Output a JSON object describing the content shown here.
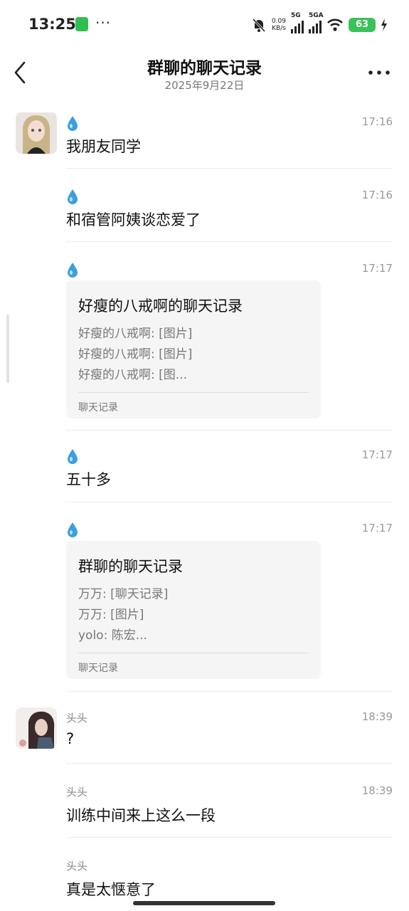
{
  "status_bar": {
    "time": "13:25",
    "dots": "···",
    "speed_value": "0.09",
    "speed_unit": "KB/s",
    "sim1": "5G",
    "sim2": "5GA",
    "battery": "63"
  },
  "header": {
    "title": "群聊的聊天记录",
    "date": "2025年9月22日"
  },
  "messages": [
    {
      "sender": "",
      "time": "17:16",
      "text": "我朋友同学"
    },
    {
      "sender": "",
      "time": "17:16",
      "text": "和宿管阿姨谈恋爱了"
    },
    {
      "sender": "",
      "time": "17:17",
      "card": {
        "title": "好瘦的八戒啊的聊天记录",
        "lines": [
          "好瘦的八戒啊: [图片]",
          "好瘦的八戒啊: [图片]",
          "好瘦的八戒啊: [图..."
        ],
        "footer": "聊天记录"
      }
    },
    {
      "sender": "",
      "time": "17:17",
      "text": "五十多"
    },
    {
      "sender": "",
      "time": "17:17",
      "card": {
        "title": "群聊的聊天记录",
        "lines": [
          "万万: [聊天记录]",
          "万万: [图片]",
          "yolo: 陈宏..."
        ],
        "footer": "聊天记录"
      }
    },
    {
      "sender": "头头",
      "time": "18:39",
      "text": "?"
    },
    {
      "sender": "头头",
      "time": "18:39",
      "text": "训练中间来上这么一段"
    },
    {
      "sender": "头头",
      "time": "",
      "text": "真是太惬意了"
    }
  ],
  "icons": {
    "back": "chevron-left-icon",
    "more": "more-dots-icon",
    "drop": "water-drop-icon"
  },
  "colors": {
    "drop": "#3aa0e0",
    "battery": "#3ac25a"
  }
}
